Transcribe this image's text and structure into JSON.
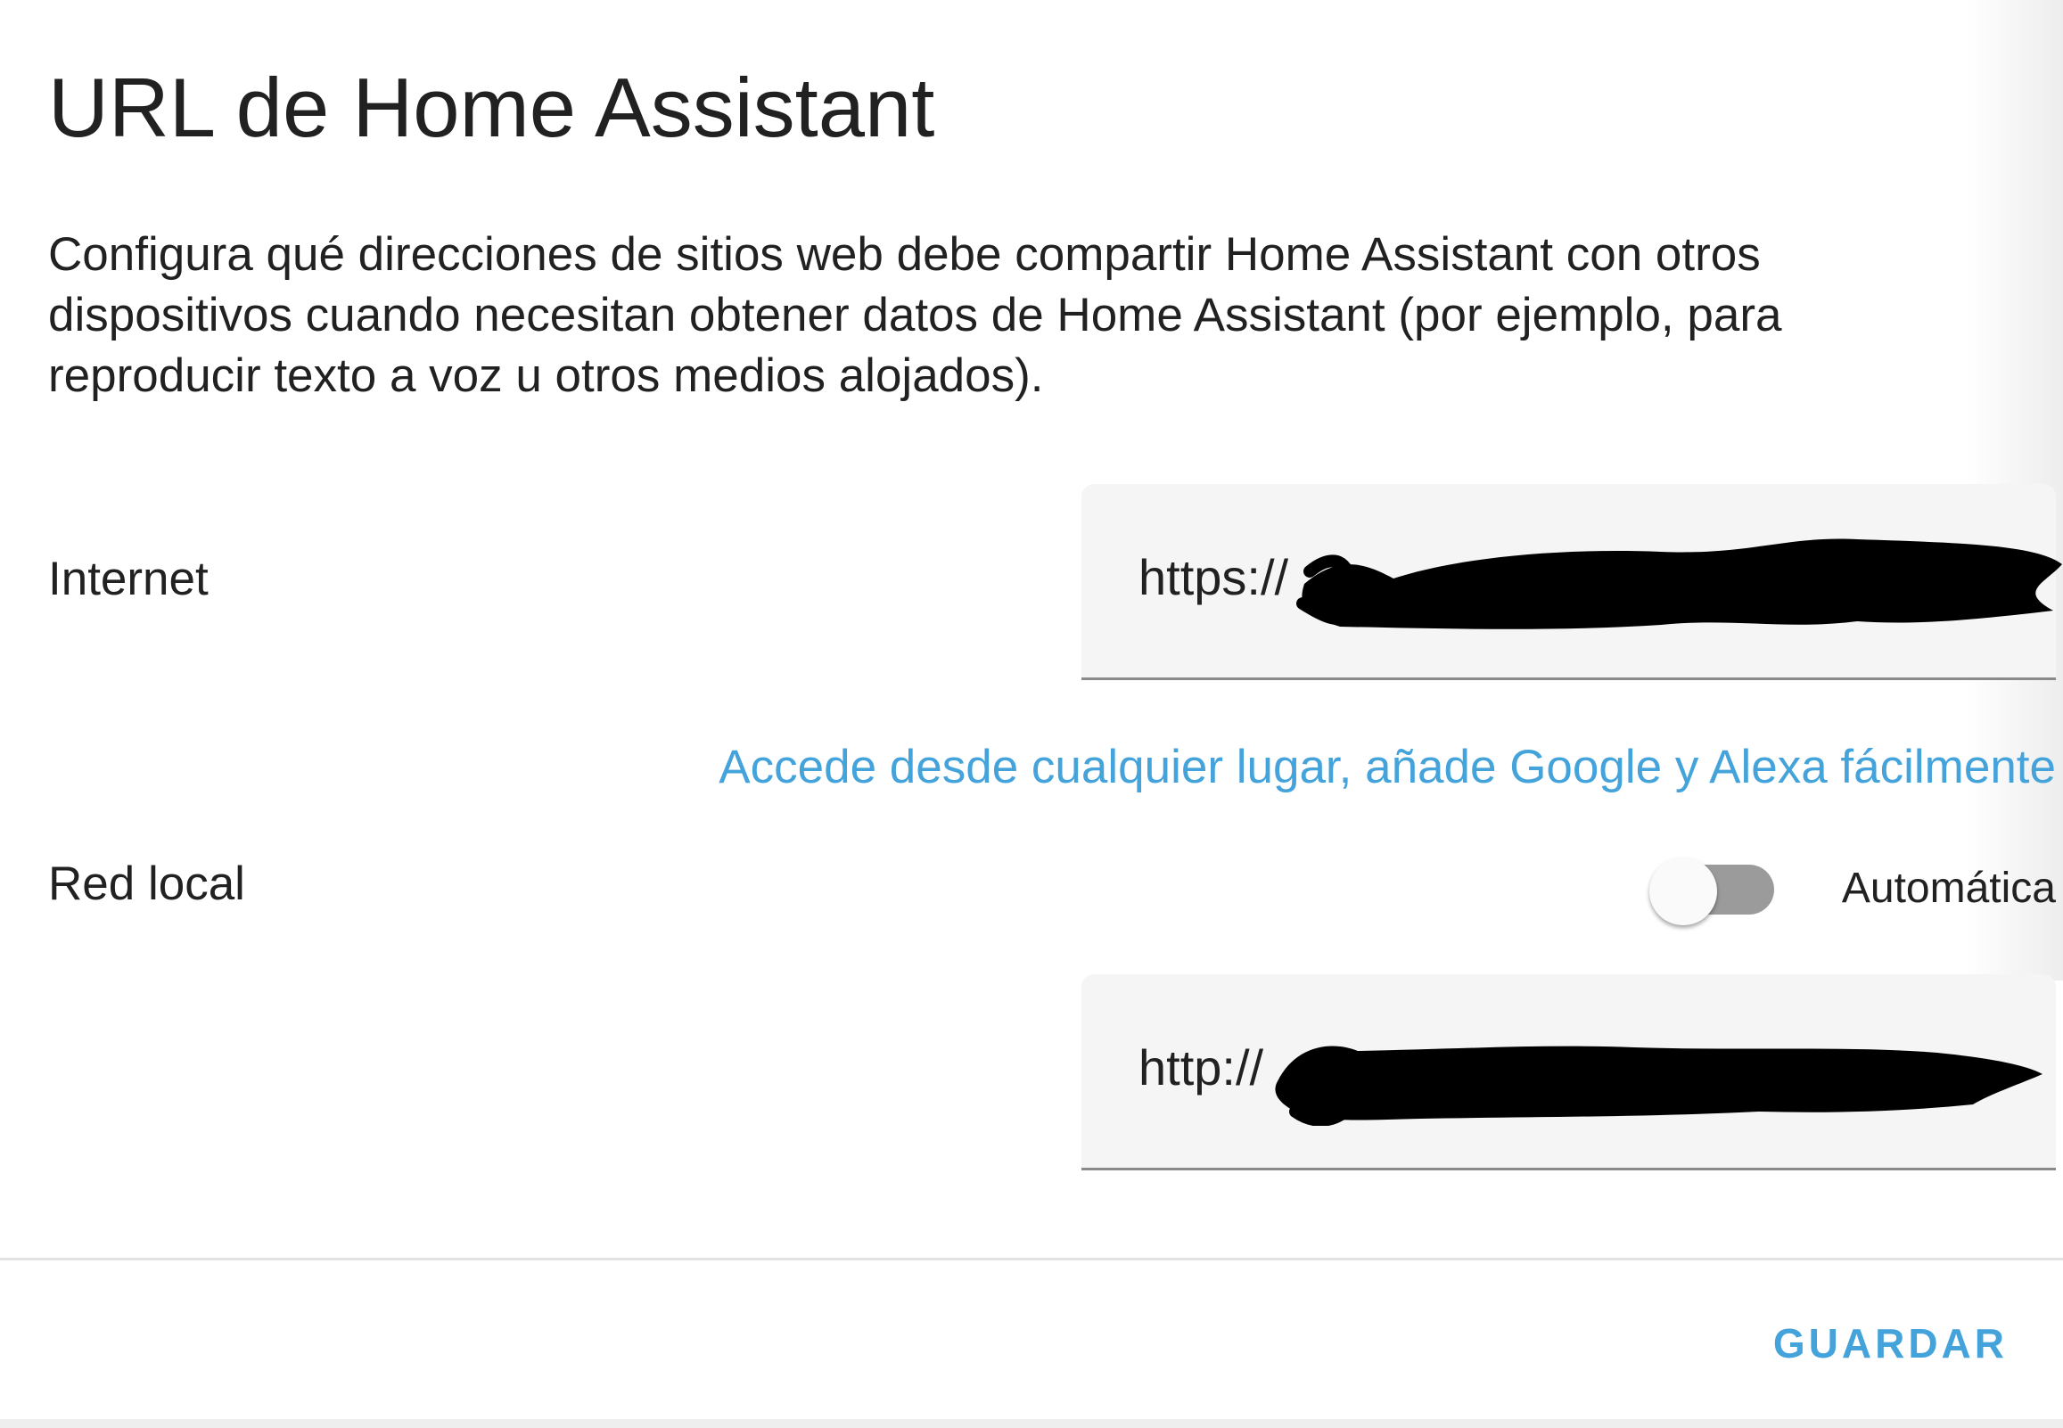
{
  "dialog": {
    "title": "URL de Home Assistant",
    "description": "Configura qué direcciones de sitios web debe compartir Home Assistant con otros dispositivos cuando necesitan obtener datos de Home Assistant (por ejemplo, para reproducir texto a voz u otros medios alojados)."
  },
  "internet": {
    "label": "Internet",
    "value": "https://",
    "cloud_link": "Accede desde cualquier lugar, añade Google y Alexa fácilmente"
  },
  "local": {
    "label": "Red local",
    "toggle_label": "Automática",
    "toggle_on": false,
    "value": "http://"
  },
  "actions": {
    "save_label": "GUARDAR"
  },
  "colors": {
    "accent": "#44a3db",
    "field_background": "#f5f5f5",
    "toggle_track": "#9b9b9b",
    "redaction": "#000000"
  }
}
